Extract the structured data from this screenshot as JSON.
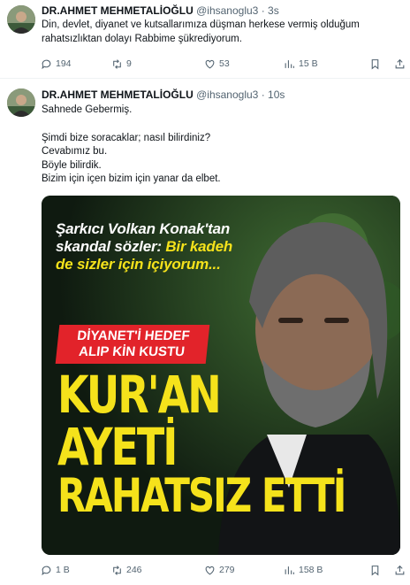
{
  "tweets": [
    {
      "author_name": "DR.AHMET MEHMETALİOĞLU",
      "handle": "@ihsanoglu3",
      "time": "3s",
      "text": [
        "Din, devlet, diyanet ve kutsallarımıza düşman herkese vermiş olduğum rahatsızlıktan dolayı Rabbime şükrediyorum."
      ],
      "replies": "194",
      "retweets": "9",
      "likes": "53",
      "views": "15 B"
    },
    {
      "author_name": "DR.AHMET MEHMETALİOĞLU",
      "handle": "@ihsanoglu3",
      "time": "10s",
      "text": [
        "Sahnede Gebermiş.",
        "",
        "Şimdi bize soracaklar; nasıl bilirdiniz?",
        "Cevabımız bu.",
        "Böyle bilirdik.",
        "Bizim için içen bizim için yanar da elbet."
      ],
      "replies": "1 B",
      "retweets": "246",
      "likes": "279",
      "views": "158 B",
      "media": {
        "quote_white": "Şarkıcı Volkan Konak'tan skandal sözler:",
        "quote_yellow": "Bir kadeh de sizler için içiyorum...",
        "red_banner": "DİYANET'İ HEDEF ALIP KİN KUSTU",
        "headline_1": "KUR'AN",
        "headline_2": "AYETİ",
        "headline_3": "RAHATSIZ ETTİ"
      }
    }
  ],
  "colors": {
    "meta": "#536471",
    "accent_yellow": "#f5e21b",
    "banner_red": "#e2232a"
  }
}
